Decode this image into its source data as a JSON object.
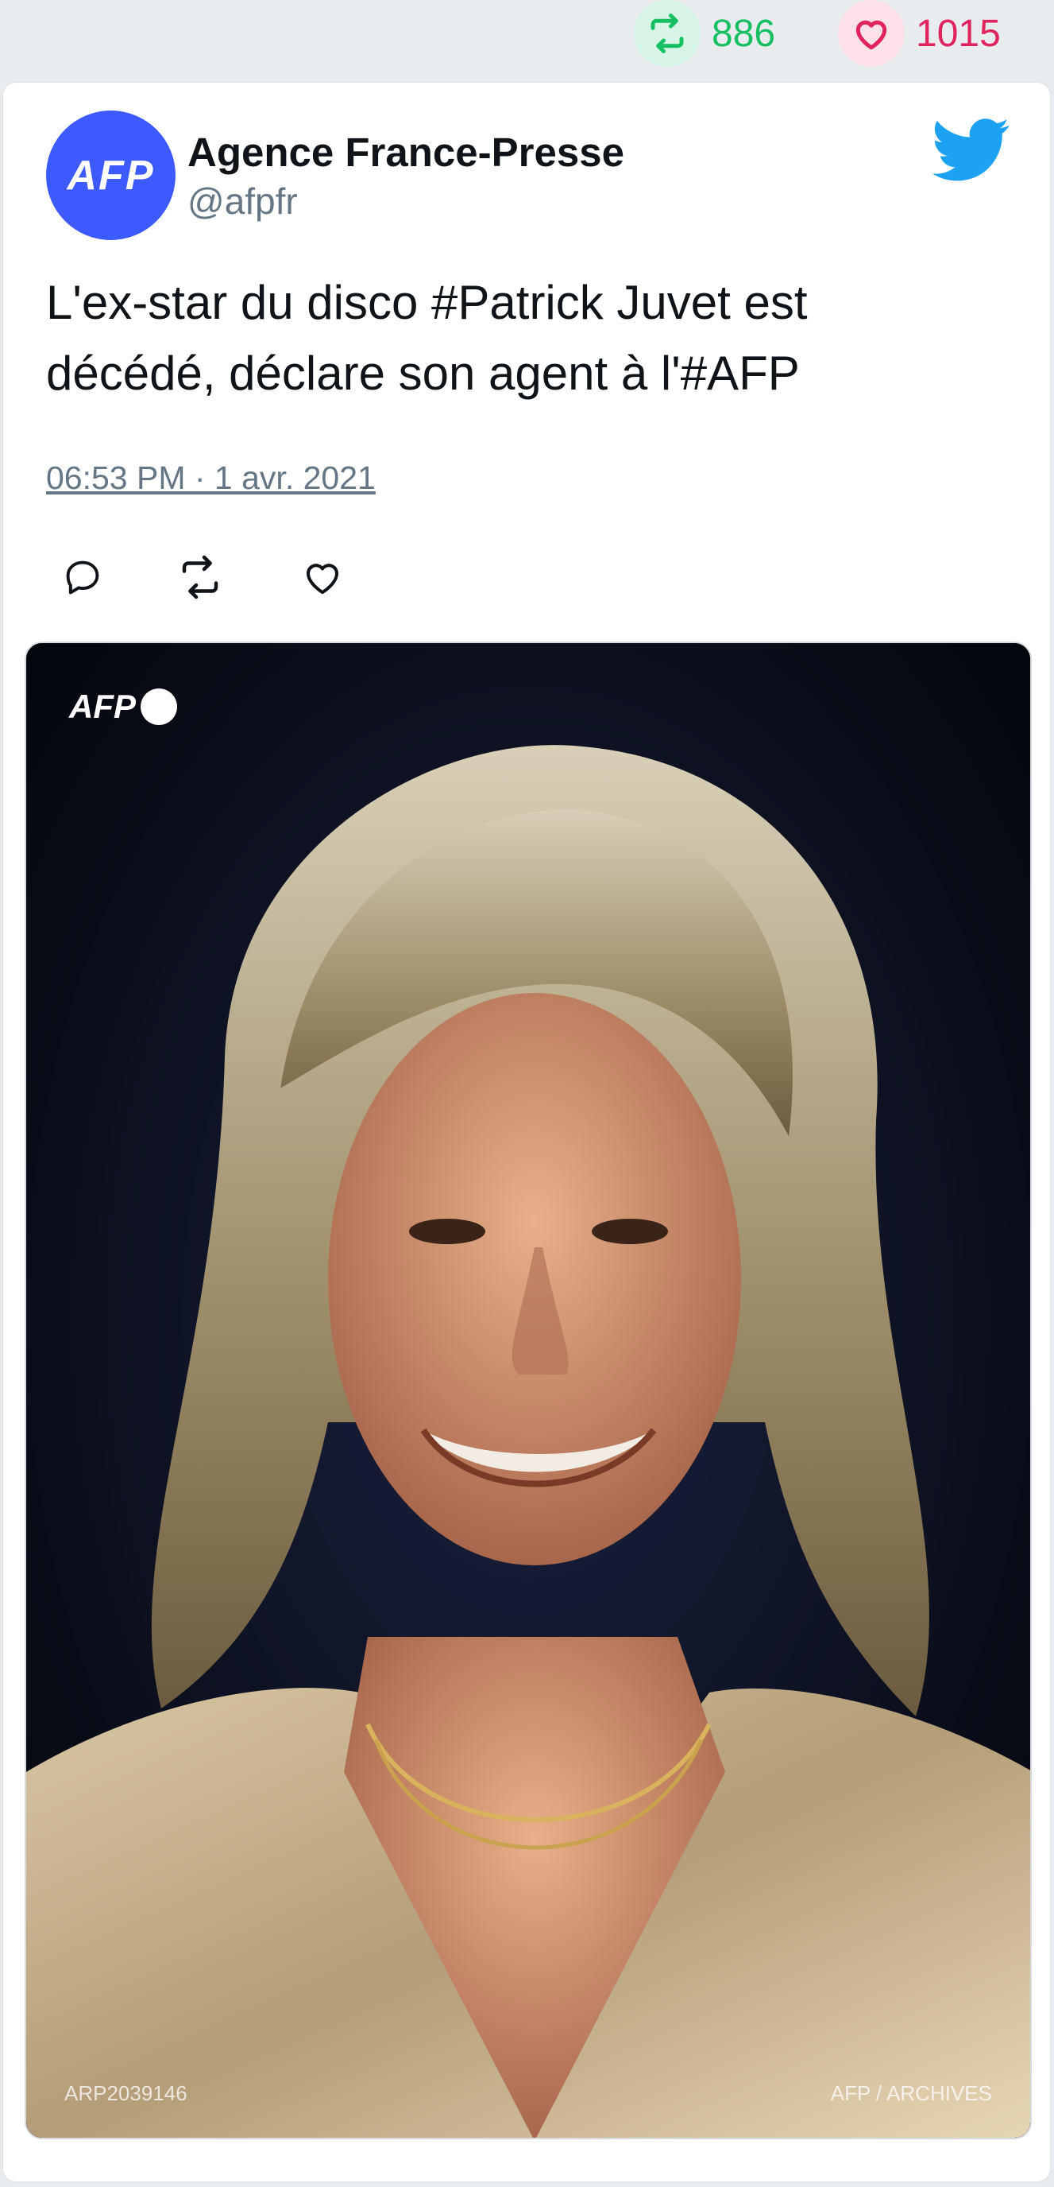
{
  "stats": {
    "retweet_icon": "retweet-icon",
    "retweet_count": "886",
    "like_icon": "heart-icon",
    "like_count": "1015"
  },
  "author": {
    "avatar_text": "AFP",
    "name": "Agence France-Presse",
    "handle": "@afpfr"
  },
  "tweet": {
    "text": "L'ex-star du disco #Patrick Juvet est décédé, déclare son agent à l'#AFP",
    "timestamp": "06:53 PM · 1 avr. 2021"
  },
  "actions": {
    "reply_icon": "reply-icon",
    "retweet_icon": "retweet-icon",
    "like_icon": "heart-icon"
  },
  "media": {
    "watermark_logo": "AFP",
    "ref": "ARP2039146",
    "credit": "AFP / ARCHIVES"
  },
  "colors": {
    "twitter_blue": "#1da1f2",
    "retweet_green": "#17bf63",
    "like_red": "#e0245e",
    "avatar_blue": "#3d5afe"
  }
}
